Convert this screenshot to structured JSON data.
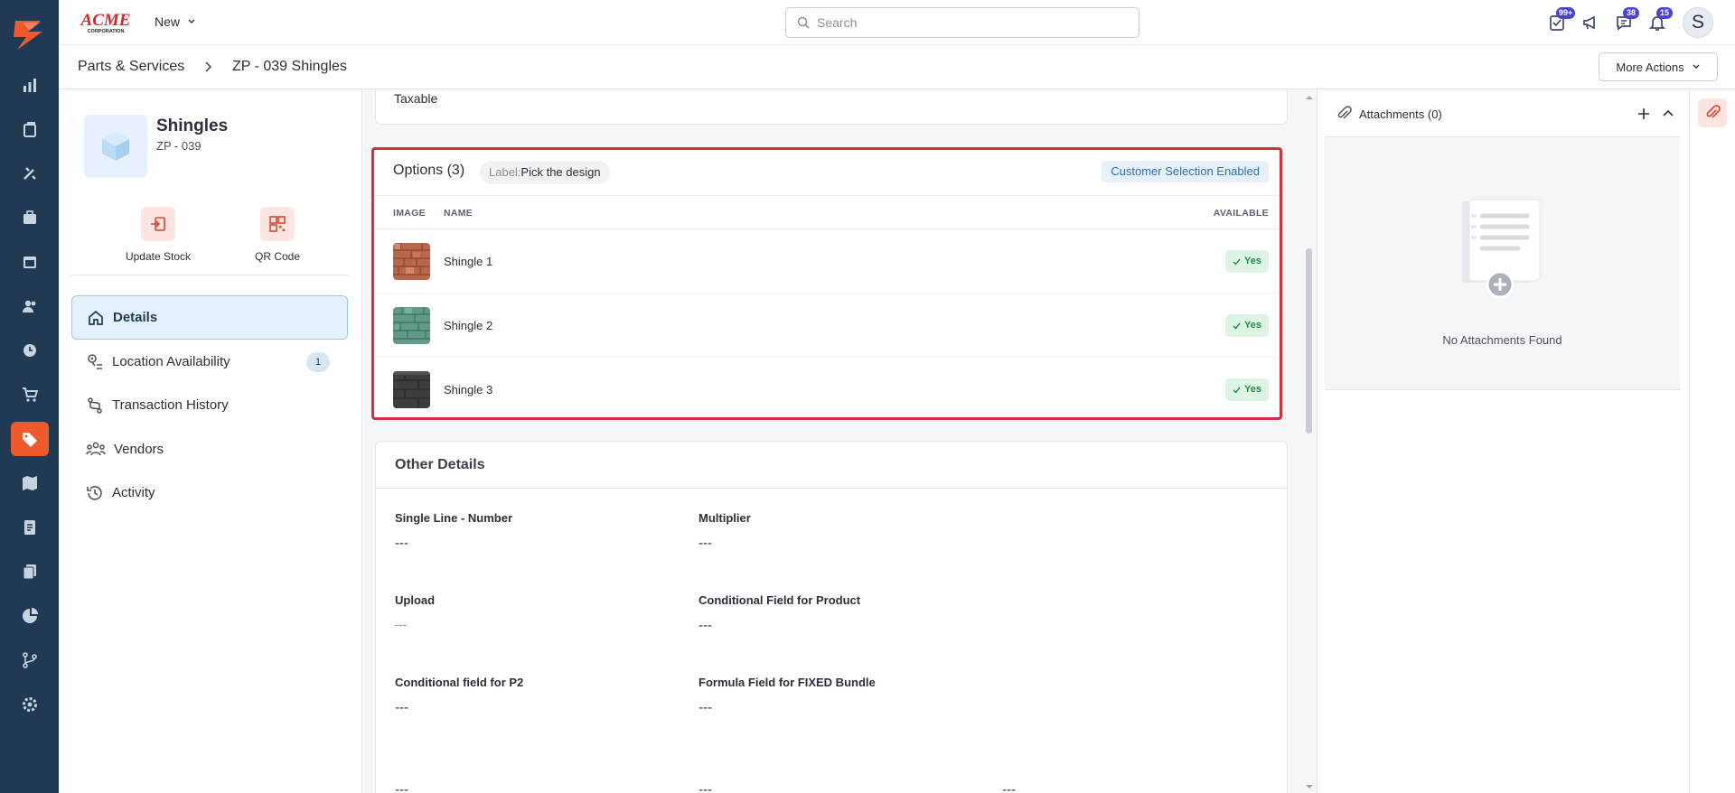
{
  "topbar": {
    "brand_main": "ACME",
    "brand_sub": "CORPORATION",
    "new_label": "New",
    "search_placeholder": "Search",
    "badges": {
      "tasks": "99+",
      "chat": "38",
      "notifications": "15"
    },
    "avatar_initial": "S"
  },
  "breadcrumb": {
    "root": "Parts & Services",
    "current": "ZP - 039 Shingles"
  },
  "actions": {
    "more_label": "More Actions"
  },
  "product": {
    "name": "Shingles",
    "code": "ZP - 039"
  },
  "quick_actions": [
    {
      "label": "Update Stock"
    },
    {
      "label": "QR Code"
    }
  ],
  "menu": [
    {
      "label": "Details",
      "active": true
    },
    {
      "label": "Location Availability",
      "count": "1"
    },
    {
      "label": "Transaction History"
    },
    {
      "label": "Vendors"
    },
    {
      "label": "Activity"
    }
  ],
  "tax": {
    "label": "Taxable"
  },
  "options": {
    "title": "Options (3)",
    "label_key": "Label:",
    "label_value": "Pick the design",
    "customer_selection": "Customer Selection Enabled",
    "columns": [
      "IMAGE",
      "NAME",
      "AVAILABLE"
    ],
    "rows": [
      {
        "name": "Shingle 1",
        "available": "Yes",
        "swatch_color": "#b9674b"
      },
      {
        "name": "Shingle 2",
        "available": "Yes",
        "swatch_color": "#5f9a8a"
      },
      {
        "name": "Shingle 3",
        "available": "Yes",
        "swatch_color": "#3b3d40"
      }
    ]
  },
  "other_details": {
    "title": "Other Details",
    "fields": [
      {
        "label": "Single Line - Number",
        "value": "---"
      },
      {
        "label": "Multiplier",
        "value": "---"
      },
      {
        "label": "Upload",
        "value": "---"
      },
      {
        "label": "Conditional Field for Product",
        "value": "---"
      },
      {
        "label": "Conditional field for P2",
        "value": "---"
      },
      {
        "label": "Formula Field for FIXED Bundle",
        "value": "---"
      }
    ],
    "trailing_values": [
      "---",
      "---",
      "---"
    ]
  },
  "attachments": {
    "title": "Attachments (0)",
    "empty_text": "No Attachments Found"
  },
  "colors": {
    "sidebar": "#1f3a52",
    "accent": "#ef5a2b",
    "highlight_border": "#d72f3a",
    "success": "#1f8f4a"
  }
}
